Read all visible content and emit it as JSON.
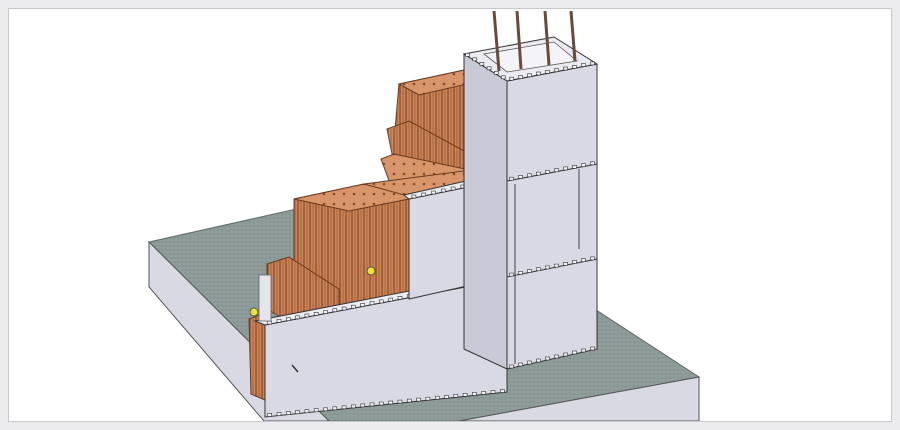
{
  "scene": {
    "description_free": true,
    "colors": {
      "frame": "#ececef",
      "background": "#ffffff",
      "slab_top": "#8f9c9a",
      "slab_side": "#d8d9e3",
      "formwork": "#d9d9e6",
      "formwork_dark": "#c7c7d6",
      "brick": "#c98356",
      "brick_dark": "#8a4b2a",
      "rebar": "#6b4a3c",
      "marker": "#e8e23a"
    },
    "icons": [
      "wall-formwork",
      "column-formwork",
      "brick-wall",
      "rebar",
      "concrete-slab"
    ]
  }
}
